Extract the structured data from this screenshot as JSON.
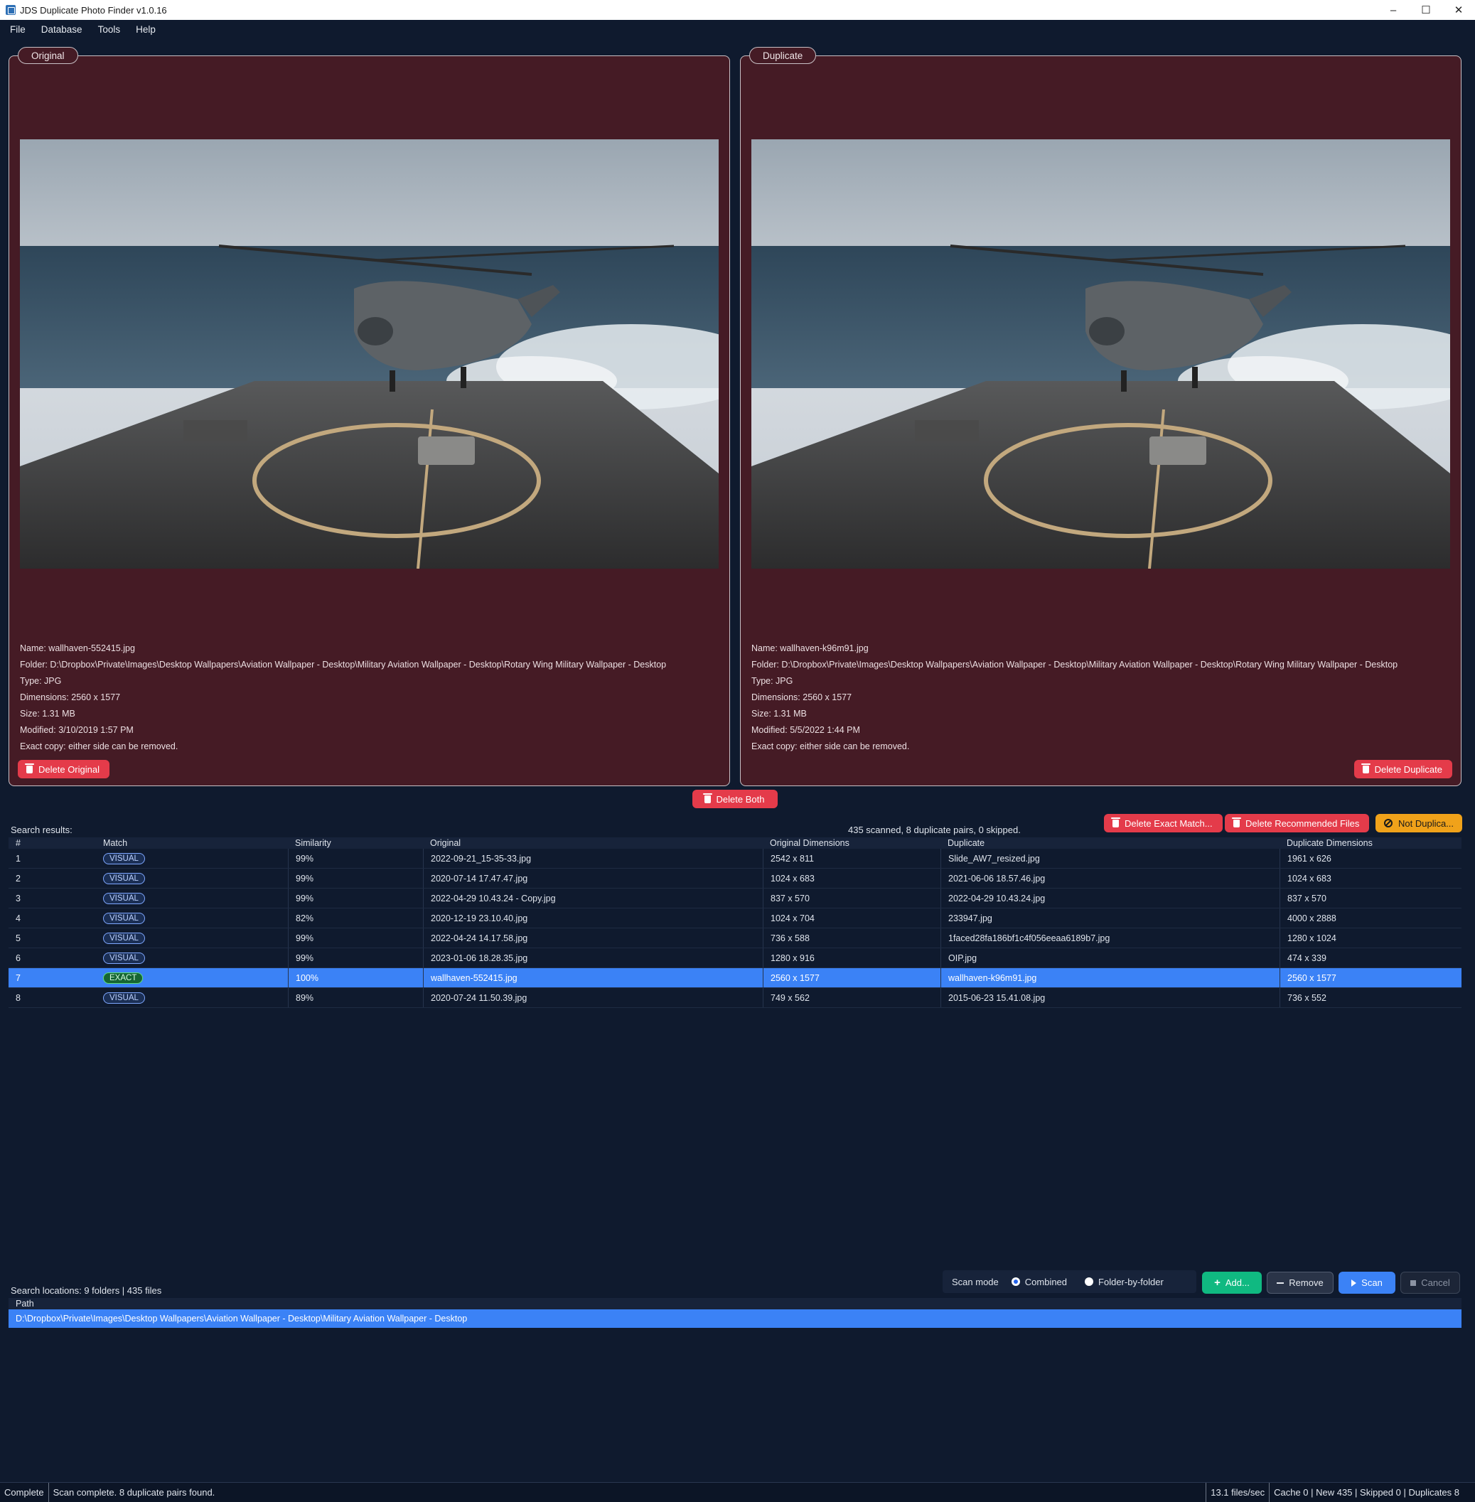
{
  "window": {
    "title": "JDS Duplicate Photo Finder v1.0.16",
    "controls": {
      "minimize": "–",
      "maximize": "☐",
      "close": "✕"
    }
  },
  "menu": [
    "File",
    "Database",
    "Tools",
    "Help"
  ],
  "original": {
    "tab": "Original",
    "name": "Name: wallhaven-552415.jpg",
    "folder": "Folder: D:\\Dropbox\\Private\\Images\\Desktop Wallpapers\\Aviation Wallpaper - Desktop\\Military Aviation Wallpaper - Desktop\\Rotary Wing Military Wallpaper - Desktop",
    "type": "Type: JPG",
    "dimensions": "Dimensions: 2560 x 1577",
    "size": "Size: 1.31 MB",
    "modified": "Modified: 3/10/2019 1:57 PM",
    "note": "Exact copy: either side can be removed.",
    "delete_label": "Delete Original"
  },
  "duplicate": {
    "tab": "Duplicate",
    "name": "Name: wallhaven-k96m91.jpg",
    "folder": "Folder: D:\\Dropbox\\Private\\Images\\Desktop Wallpapers\\Aviation Wallpaper - Desktop\\Military Aviation Wallpaper - Desktop\\Rotary Wing Military Wallpaper - Desktop",
    "type": "Type: JPG",
    "dimensions": "Dimensions: 2560 x 1577",
    "size": "Size: 1.31 MB",
    "modified": "Modified: 5/5/2022 1:44 PM",
    "note": "Exact copy: either side can be removed.",
    "delete_label": "Delete Duplicate"
  },
  "delete_both_label": "Delete Both",
  "results": {
    "label": "Search results:",
    "status": "435 scanned, 8 duplicate pairs, 0 skipped.",
    "actions": {
      "delete_exact": "Delete Exact Match...",
      "delete_recommended": "Delete Recommended Files",
      "not_duplicate": "Not Duplica..."
    },
    "columns": [
      "#",
      "Match",
      "Similarity",
      "Original",
      "Original Dimensions",
      "Duplicate",
      "Duplicate Dimensions"
    ],
    "rows": [
      [
        "1",
        "VISUAL",
        "99%",
        "2022-09-21_15-35-33.jpg",
        "2542 x 811",
        "Slide_AW7_resized.jpg",
        "1961 x 626"
      ],
      [
        "2",
        "VISUAL",
        "99%",
        "2020-07-14 17.47.47.jpg",
        "1024 x 683",
        "2021-06-06 18.57.46.jpg",
        "1024 x 683"
      ],
      [
        "3",
        "VISUAL",
        "99%",
        "2022-04-29 10.43.24 - Copy.jpg",
        "837 x 570",
        "2022-04-29 10.43.24.jpg",
        "837 x 570"
      ],
      [
        "4",
        "VISUAL",
        "82%",
        "2020-12-19 23.10.40.jpg",
        "1024 x 704",
        "233947.jpg",
        "4000 x 2888"
      ],
      [
        "5",
        "VISUAL",
        "99%",
        "2022-04-24 14.17.58.jpg",
        "736 x 588",
        "1faced28fa186bf1c4f056eeaa6189b7.jpg",
        "1280 x 1024"
      ],
      [
        "6",
        "VISUAL",
        "99%",
        "2023-01-06 18.28.35.jpg",
        "1280 x 916",
        "OIP.jpg",
        "474 x 339"
      ],
      [
        "7",
        "EXACT",
        "100%",
        "wallhaven-552415.jpg",
        "2560 x 1577",
        "wallhaven-k96m91.jpg",
        "2560 x 1577"
      ],
      [
        "8",
        "VISUAL",
        "89%",
        "2020-07-24 11.50.39.jpg",
        "749 x 562",
        "2015-06-23 15.41.08.jpg",
        "736 x 552"
      ]
    ],
    "selected_row": 7
  },
  "scan": {
    "mode_label": "Scan mode",
    "modes": [
      "Combined",
      "Folder-by-folder"
    ],
    "selected_mode": "Combined",
    "add_label": "Add...",
    "remove_label": "Remove",
    "scan_label": "Scan",
    "cancel_label": "Cancel"
  },
  "locations": {
    "label": "Search locations: 9 folders | 435 files",
    "column": "Path",
    "rows": [
      "D:\\Dropbox\\Private\\Images\\Desktop Wallpapers\\Aviation Wallpaper - Desktop\\Military Aviation Wallpaper - Desktop"
    ]
  },
  "statusbar": {
    "state": "Complete",
    "message": "Scan complete. 8 duplicate pairs found.",
    "rate": "13.1 files/sec",
    "stats": "Cache 0 | New 435 | Skipped 0 | Duplicates 8"
  },
  "colors": {
    "background": "#0f1a2e",
    "panel": "#451b25",
    "danger": "#e43b4a",
    "warning": "#f0a21a",
    "accent": "#3b82f6",
    "success": "#10b981"
  }
}
